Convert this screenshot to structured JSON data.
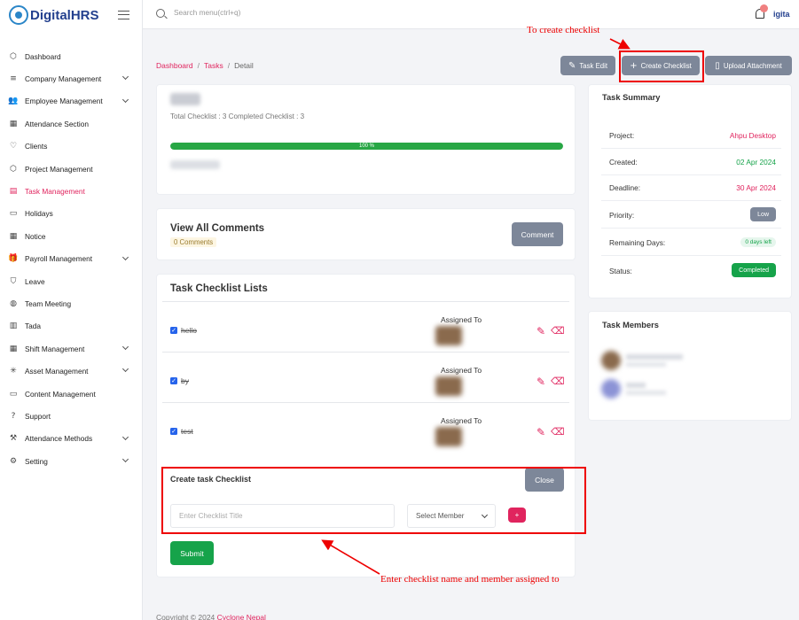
{
  "brand": {
    "name": "DigitalHRS",
    "user_short": "igita"
  },
  "search": {
    "placeholder": "Search menu(ctrl+q)"
  },
  "sidebar": {
    "items": [
      {
        "label": "Dashboard",
        "icon": "cube-icon",
        "glyph": "⬡",
        "chevron": false,
        "active": false
      },
      {
        "label": "Company Management",
        "icon": "list-icon",
        "glyph": "≡",
        "chevron": true,
        "active": false
      },
      {
        "label": "Employee Management",
        "icon": "users-icon",
        "glyph": "👥",
        "chevron": true,
        "active": false
      },
      {
        "label": "Attendance Section",
        "icon": "calendar-icon",
        "glyph": "▦",
        "chevron": false,
        "active": false
      },
      {
        "label": "Clients",
        "icon": "heart-icon",
        "glyph": "♡",
        "chevron": false,
        "active": false
      },
      {
        "label": "Project Management",
        "icon": "box-icon",
        "glyph": "⬡",
        "chevron": false,
        "active": false
      },
      {
        "label": "Task Management",
        "icon": "table-icon",
        "glyph": "▤",
        "chevron": false,
        "active": true
      },
      {
        "label": "Holidays",
        "icon": "card-icon",
        "glyph": "▭",
        "chevron": false,
        "active": false
      },
      {
        "label": "Notice",
        "icon": "calendar-icon",
        "glyph": "▦",
        "chevron": false,
        "active": false
      },
      {
        "label": "Payroll Management",
        "icon": "gift-icon",
        "glyph": "🎁",
        "chevron": true,
        "active": false
      },
      {
        "label": "Leave",
        "icon": "bookmark-icon",
        "glyph": "⛉",
        "chevron": false,
        "active": false
      },
      {
        "label": "Team Meeting",
        "icon": "globe-icon",
        "glyph": "◍",
        "chevron": false,
        "active": false
      },
      {
        "label": "Tada",
        "icon": "book-icon",
        "glyph": "▥",
        "chevron": false,
        "active": false
      },
      {
        "label": "Shift Management",
        "icon": "calendar-icon",
        "glyph": "▦",
        "chevron": true,
        "active": false
      },
      {
        "label": "Asset Management",
        "icon": "loader-icon",
        "glyph": "✳",
        "chevron": true,
        "active": false
      },
      {
        "label": "Content Management",
        "icon": "monitor-icon",
        "glyph": "▭",
        "chevron": false,
        "active": false
      },
      {
        "label": "Support",
        "icon": "help-icon",
        "glyph": "?",
        "chevron": false,
        "active": false
      },
      {
        "label": "Attendance Methods",
        "icon": "tool-icon",
        "glyph": "⚒",
        "chevron": true,
        "active": false
      },
      {
        "label": "Setting",
        "icon": "gear-icon",
        "glyph": "⚙",
        "chevron": true,
        "active": false
      }
    ]
  },
  "breadcrumb": {
    "home": "Dashboard",
    "section": "Tasks",
    "current": "Detail"
  },
  "actions": {
    "task_edit": "Task Edit",
    "create_checklist": "Create Checklist",
    "upload_attachment": "Upload Attachment"
  },
  "task": {
    "stats": "Total Checklist : 3   Completed Checklist : 3",
    "progress_label": "100 %",
    "progress": 1.0
  },
  "comments": {
    "title": "View All Comments",
    "count": "0 Comments",
    "button": "Comment"
  },
  "checklist": {
    "title": "Task Checklist Lists",
    "assigned_label": "Assigned To",
    "items": [
      {
        "name": "hello"
      },
      {
        "name": "by"
      },
      {
        "name": "test"
      }
    ]
  },
  "create_form": {
    "title": "Create task Checklist",
    "close": "Close",
    "title_placeholder": "Enter Checklist Title",
    "member_select": "Select Member",
    "add": "+",
    "submit": "Submit"
  },
  "summary": {
    "title": "Task Summary",
    "project_label": "Project:",
    "project": "Ahpu Desktop",
    "created_label": "Created:",
    "created": "02 Apr 2024",
    "deadline_label": "Deadline:",
    "deadline": "30 Apr 2024",
    "priority_label": "Priority:",
    "priority": "Low",
    "remaining_label": "Remaining Days:",
    "remaining": "0 days left",
    "status_label": "Status:",
    "status": "Completed"
  },
  "members": {
    "title": "Task Members"
  },
  "footer": {
    "text": "Copyright © 2024 ",
    "brand": "Cyclone Nepal"
  },
  "annotations": {
    "top": "To create checklist",
    "bottom": "Enter checklist name and member assigned to"
  },
  "colors": {
    "accent": "#e0245e",
    "brand": "#23408e",
    "success": "#16a34a",
    "muted_button": "#7d8799",
    "highlight": "#ee0000"
  }
}
